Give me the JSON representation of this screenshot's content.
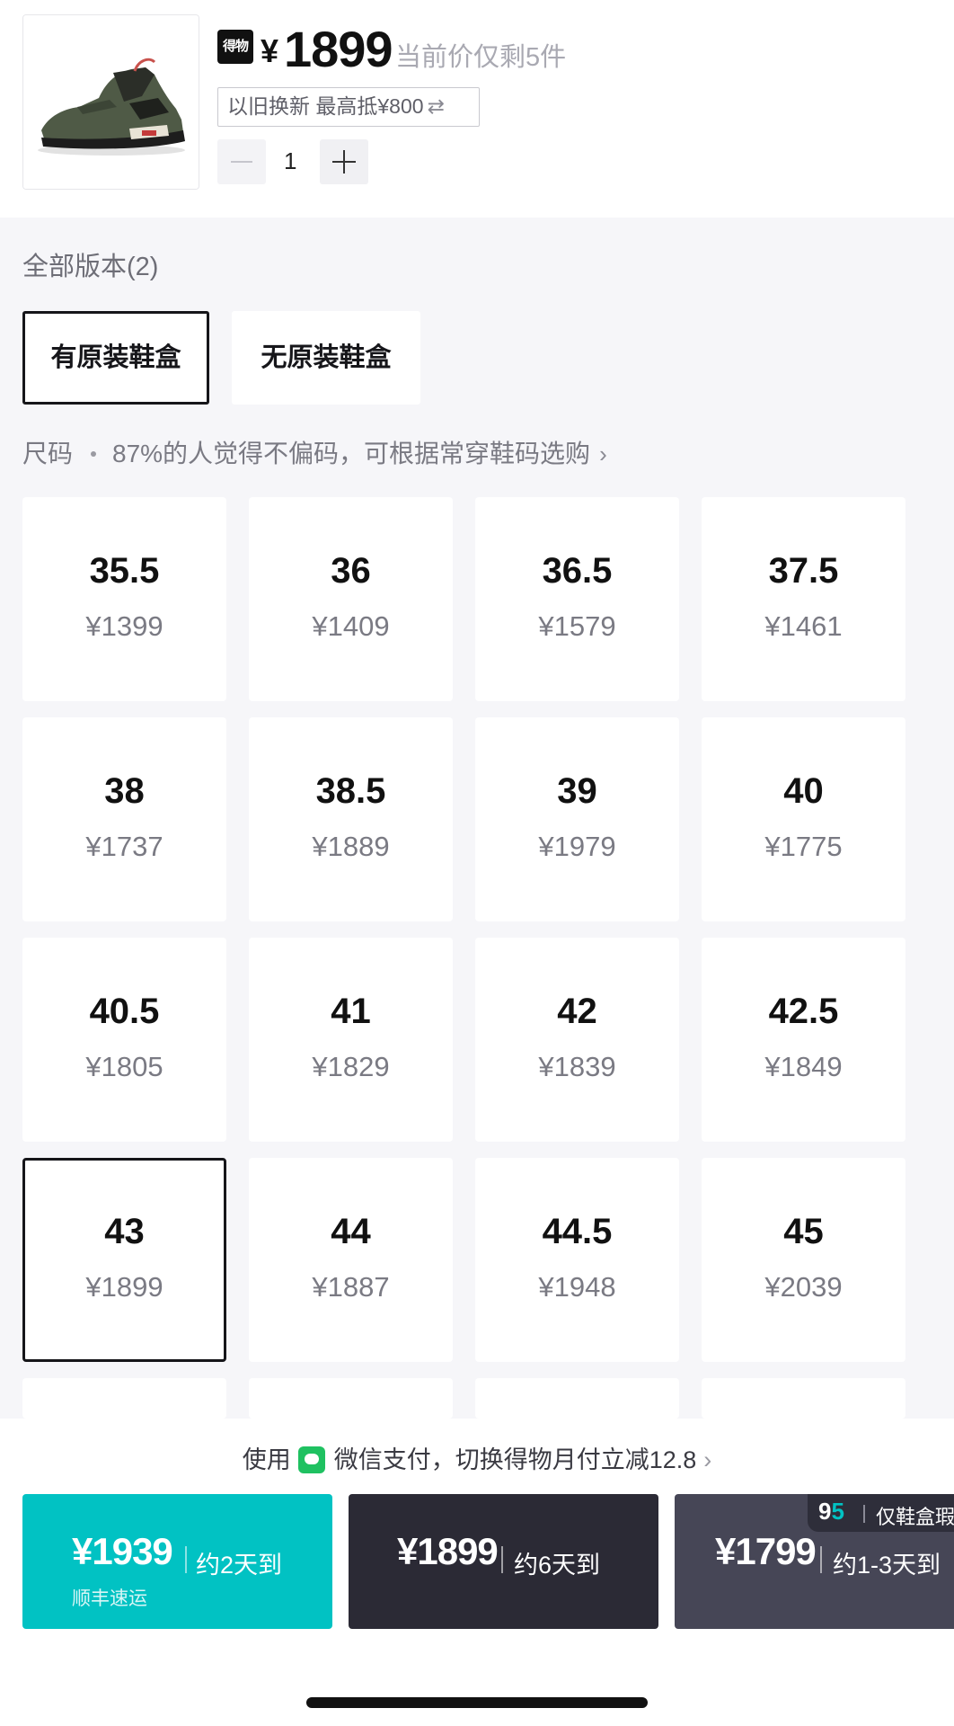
{
  "product": {
    "brand_label": "得物",
    "currency_symbol": "¥",
    "price": "1899",
    "stock_note": "当前价仅剩5件",
    "tradein_label": "以旧换新 最高抵¥800",
    "tradein_icon": "swap-arrows-icon",
    "quantity": "1"
  },
  "versions": {
    "title": "全部版本(2)",
    "options": [
      {
        "label": "有原装鞋盒",
        "selected": true
      },
      {
        "label": "无原装鞋盒",
        "selected": false
      }
    ]
  },
  "size_section": {
    "label": "尺码",
    "hint": "87%的人觉得不偏码，可根据常穿鞋码选购",
    "chevron": "›"
  },
  "sizes": [
    {
      "size": "35.5",
      "price": "¥1399"
    },
    {
      "size": "36",
      "price": "¥1409"
    },
    {
      "size": "36.5",
      "price": "¥1579"
    },
    {
      "size": "37.5",
      "price": "¥1461"
    },
    {
      "size": "38",
      "price": "¥1737"
    },
    {
      "size": "38.5",
      "price": "¥1889"
    },
    {
      "size": "39",
      "price": "¥1979"
    },
    {
      "size": "40",
      "price": "¥1775"
    },
    {
      "size": "40.5",
      "price": "¥1805"
    },
    {
      "size": "41",
      "price": "¥1829"
    },
    {
      "size": "42",
      "price": "¥1839"
    },
    {
      "size": "42.5",
      "price": "¥1849"
    },
    {
      "size": "43",
      "price": "¥1899",
      "selected": true
    },
    {
      "size": "44",
      "price": "¥1887"
    },
    {
      "size": "44.5",
      "price": "¥1948"
    },
    {
      "size": "45",
      "price": "¥2039"
    }
  ],
  "promo": {
    "prefix": "使用",
    "icon": "wechat-pay-icon",
    "text": "微信支付，切换得物月付立减12.8",
    "chevron": "›"
  },
  "buy_options": [
    {
      "amount": "¥1939",
      "eta": "约2天到",
      "sub": "顺丰速运",
      "color": "#01c2c3"
    },
    {
      "amount": "¥1899",
      "eta": "约6天到",
      "color": "#2b2a35"
    },
    {
      "amount": "¥1799",
      "eta": "约1-3天到",
      "tag_logo_main": "9",
      "tag_logo_accent": "5",
      "tag_text": "仅鞋盒瑕",
      "color": "#464656"
    }
  ],
  "colors": {
    "accent_teal": "#01c2c3",
    "dark_button": "#2b2a35",
    "gray_button": "#464656",
    "background": "#f6f6f9"
  }
}
